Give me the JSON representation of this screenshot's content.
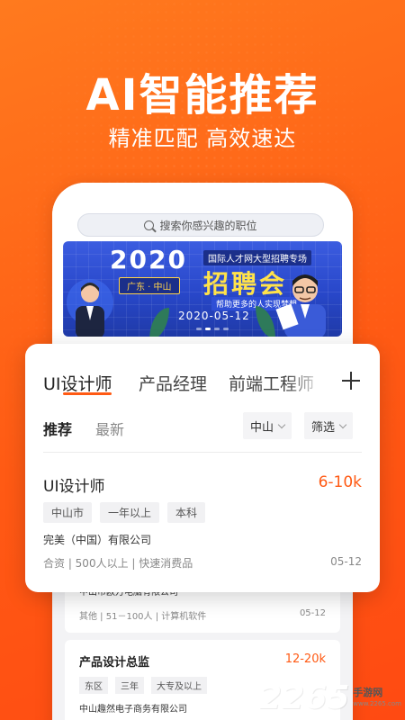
{
  "hero": {
    "title": "AI智能推荐",
    "subtitle": "精准匹配 高效速达"
  },
  "phone": {
    "search_placeholder": "搜索你感兴趣的职位",
    "banner": {
      "year": "2020",
      "place": "广东 · 中山",
      "tag": "国际人才网大型招聘专场",
      "title": "招聘会",
      "slogan": "帮助更多的人实现梦想",
      "date": "2020-05-12"
    },
    "back_cards": [
      {
        "company": "中山市欧万电脑有限公司",
        "meta": "其他 | 51－100人 | 计算机软件",
        "date": "05-12"
      },
      {
        "title": "产品设计总监",
        "salary": "12-20k",
        "chips": [
          "东区",
          "三年",
          "大专及以上"
        ],
        "company": "中山趣然电子商务有限公司"
      }
    ]
  },
  "card": {
    "tabs": [
      "UI设计师",
      "产品经理",
      "前端工程师"
    ],
    "active_tab": "UI设计师",
    "subtabs": [
      "推荐",
      "最新"
    ],
    "filters": [
      "中山",
      "筛选"
    ],
    "job": {
      "title": "UI设计师",
      "salary": "6-10k",
      "chips": [
        "中山市",
        "一年以上",
        "本科"
      ],
      "company": "完美（中国）有限公司",
      "meta": "合资 | 500人以上 | 快速消费品",
      "date": "05-12"
    }
  },
  "watermark": {
    "number": "2265",
    "label": "手游网",
    "url": "www.2265.com"
  },
  "colors": {
    "accent": "#ff5a14",
    "background": "#ff6a1a",
    "banner_blue": "#2847c9"
  }
}
